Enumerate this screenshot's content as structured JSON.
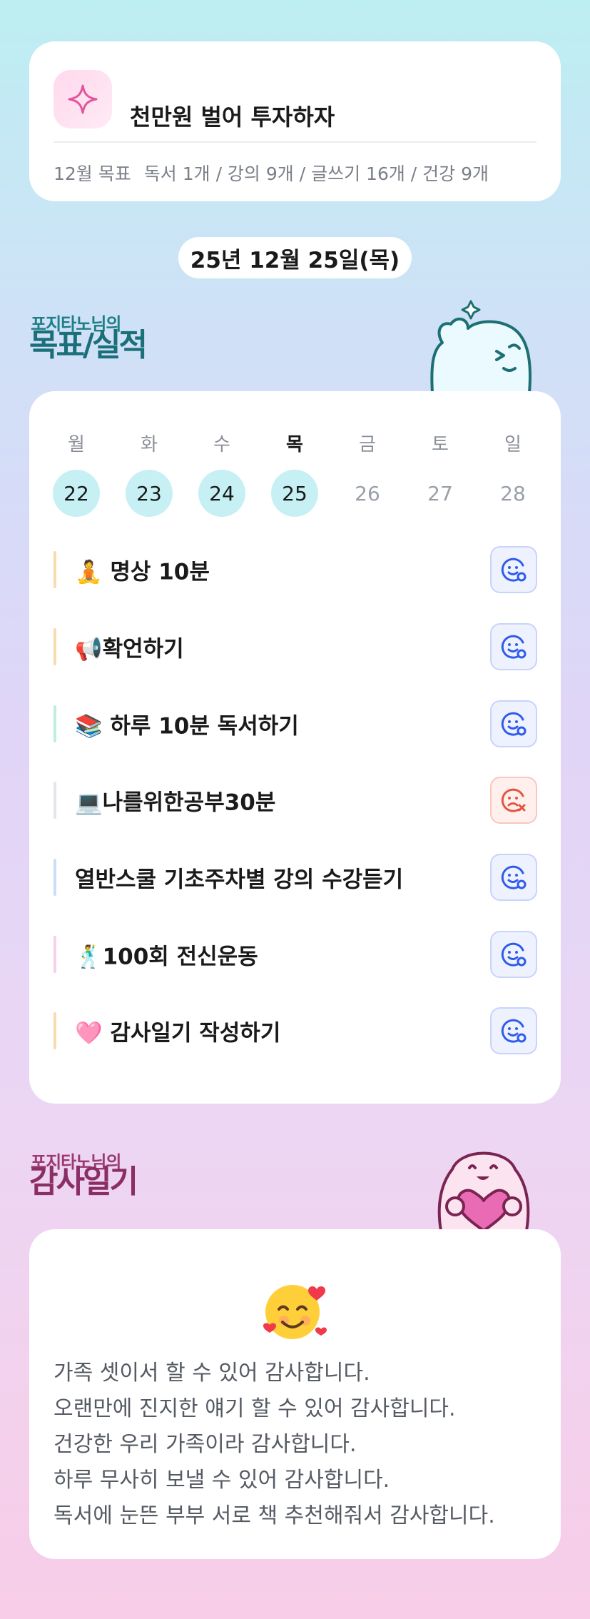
{
  "goal": {
    "icon": "sparkle-icon",
    "title": "천만원 벌어 투자하자",
    "summary_month": "12월 목표",
    "summary_items": "독서 1개 / 강의 9개 / 글쓰기 16개 / 건강 9개"
  },
  "date": "25년 12월 25일(목)",
  "goals_section": {
    "subtitle": "포지타노님의",
    "title": "목표/실적"
  },
  "calendar": {
    "weekdays": [
      "월",
      "화",
      "수",
      "목",
      "금",
      "토",
      "일"
    ],
    "days": [
      "22",
      "23",
      "24",
      "25",
      "26",
      "27",
      "28"
    ],
    "completed_count": 4
  },
  "tasks": [
    {
      "label": "🧘 명상 10분",
      "status": "success",
      "bar_color": "#f7dcae"
    },
    {
      "label": "📢확언하기",
      "status": "success",
      "bar_color": "#f7dcae"
    },
    {
      "label": "📚 하루 10분 독서하기",
      "status": "success",
      "bar_color": "#bfeede"
    },
    {
      "label": "💻나를위한공부30분",
      "status": "fail",
      "bar_color": "#e3e5ea"
    },
    {
      "label": "열반스쿨 기초주차별 강의 수강듣기",
      "status": "success",
      "bar_color": "#cfdcf7"
    },
    {
      "label": "🕺100회 전신운동",
      "status": "success",
      "bar_color": "#f8d0ea"
    },
    {
      "label": "🩷 감사일기 작성하기",
      "status": "success",
      "bar_color": "#f7dcae"
    }
  ],
  "diary_section": {
    "subtitle": "포지타노님의",
    "title": "감사일기"
  },
  "diary": {
    "emoji": "smiling-face-with-hearts",
    "lines": [
      "가족 셋이서 할 수 있어 감사합니다.",
      "오랜만에 진지한 얘기 할 수 있어 감사합니다.",
      "건강한 우리 가족이라 감사합니다.",
      "하루 무사히 보낼 수 있어 감사합니다.",
      "독서에 눈뜬 부부 서로 책 추천해줘서 감사합니다."
    ]
  },
  "colors": {
    "teal_title": "#1a6f78",
    "plum_title": "#8b2e66",
    "done_circle": "#c6f0f4",
    "success_icon": "#2f5bea",
    "fail_icon": "#e5533f"
  }
}
